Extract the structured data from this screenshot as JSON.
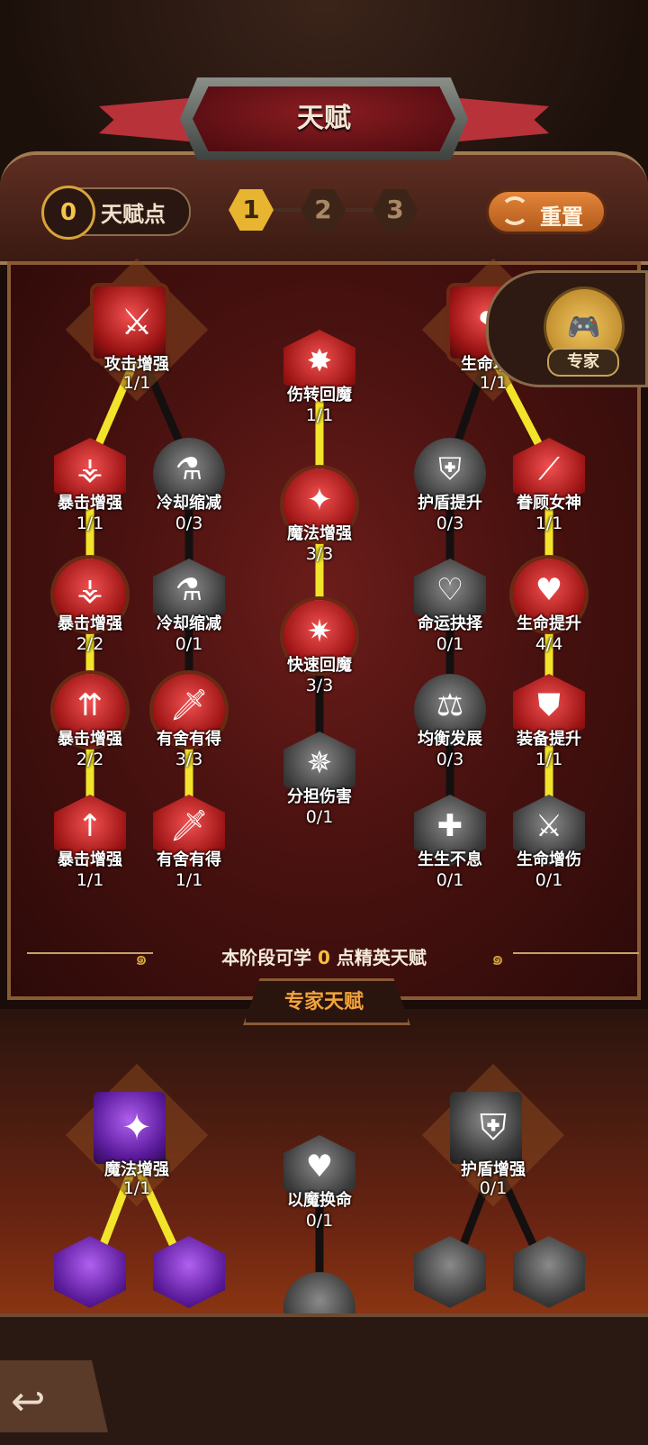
{
  "header": {
    "title": "天赋",
    "talent_points_value": "0",
    "talent_points_label": "天赋点",
    "pages": [
      "1",
      "2",
      "3"
    ],
    "active_page": "1",
    "reset_label": "重置"
  },
  "expert_badge": {
    "label": "专家"
  },
  "tree": {
    "nodes": [
      {
        "id": "n1",
        "name": "攻击增强",
        "level": "1/1"
      },
      {
        "id": "n2",
        "name": "伤转回魔",
        "level": "1/1"
      },
      {
        "id": "n3",
        "name": "生命增强",
        "level": "1/1"
      },
      {
        "id": "n4",
        "name": "暴击增强",
        "level": "1/1"
      },
      {
        "id": "n5",
        "name": "冷却缩减",
        "level": "0/3"
      },
      {
        "id": "n6",
        "name": "魔法增强",
        "level": "3/3"
      },
      {
        "id": "n7",
        "name": "护盾提升",
        "level": "0/3"
      },
      {
        "id": "n8",
        "name": "眷顾女神",
        "level": "1/1"
      },
      {
        "id": "n9",
        "name": "暴击增强",
        "level": "2/2"
      },
      {
        "id": "n10",
        "name": "冷却缩减",
        "level": "0/1"
      },
      {
        "id": "n11",
        "name": "快速回魔",
        "level": "3/3"
      },
      {
        "id": "n12",
        "name": "命运抉择",
        "level": "0/1"
      },
      {
        "id": "n13",
        "name": "生命提升",
        "level": "4/4"
      },
      {
        "id": "n14",
        "name": "暴击增强",
        "level": "2/2"
      },
      {
        "id": "n15",
        "name": "有舍有得",
        "level": "3/3"
      },
      {
        "id": "n16",
        "name": "分担伤害",
        "level": "0/1"
      },
      {
        "id": "n17",
        "name": "均衡发展",
        "level": "0/3"
      },
      {
        "id": "n18",
        "name": "装备提升",
        "level": "1/1"
      },
      {
        "id": "n19",
        "name": "暴击增强",
        "level": "1/1"
      },
      {
        "id": "n20",
        "name": "有舍有得",
        "level": "1/1"
      },
      {
        "id": "n21",
        "name": "生生不息",
        "level": "0/1"
      },
      {
        "id": "n22",
        "name": "生命增伤",
        "level": "0/1"
      }
    ]
  },
  "phase": {
    "prefix": "本阶段可学",
    "count": "0",
    "suffix": "点精英天赋"
  },
  "expert_section": {
    "title": "专家天赋",
    "nodes": [
      {
        "id": "e1",
        "name": "魔法增强",
        "level": "1/1"
      },
      {
        "id": "e2",
        "name": "以魔换命",
        "level": "0/1"
      },
      {
        "id": "e3",
        "name": "护盾增强",
        "level": "0/1"
      }
    ]
  },
  "colors": {
    "active": "#e8b530",
    "learned": "#c81e1e",
    "locked": "#4a4a4a",
    "connector_active": "#f2e42a"
  }
}
